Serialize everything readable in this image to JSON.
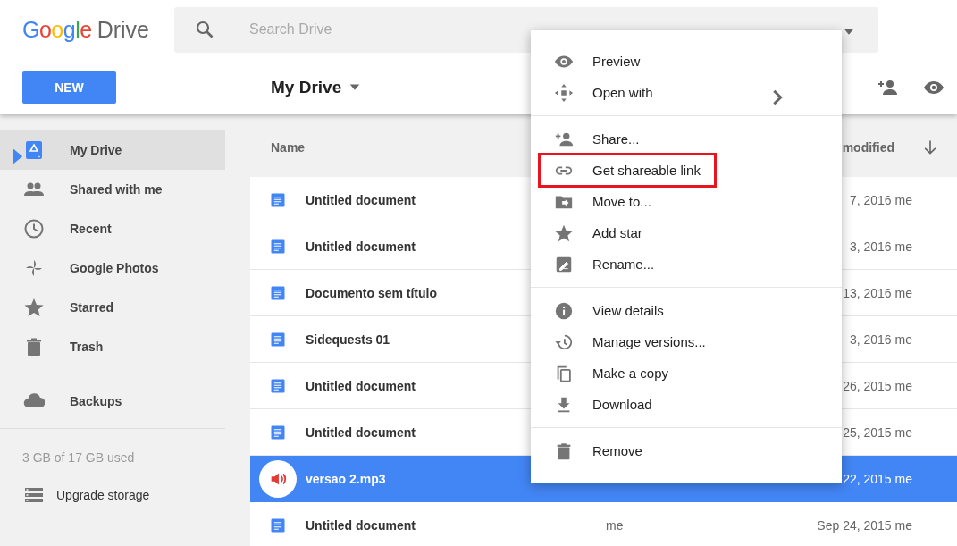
{
  "header": {
    "logo": "Google",
    "product": "Drive",
    "search": {
      "placeholder": "Search Drive"
    },
    "new_button": "NEW",
    "location": "My Drive"
  },
  "sidebar": {
    "items": [
      {
        "label": "My Drive",
        "selected": true,
        "expandable": true
      },
      {
        "label": "Shared with me",
        "selected": false,
        "expandable": false
      },
      {
        "label": "Recent",
        "selected": false,
        "expandable": false
      },
      {
        "label": "Google Photos",
        "selected": false,
        "expandable": false
      },
      {
        "label": "Starred",
        "selected": false,
        "expandable": false
      },
      {
        "label": "Trash",
        "selected": false,
        "expandable": false
      }
    ],
    "backups": "Backups",
    "storage": "3 GB of 17 GB used",
    "upgrade": "Upgrade storage"
  },
  "file_list": {
    "columns": [
      "Name",
      "modified"
    ],
    "rows": [
      {
        "kind": "doc",
        "name": "Untitled document",
        "date": "7, 2016 me",
        "selected": false
      },
      {
        "kind": "doc",
        "name": "Untitled document",
        "date": "3, 2016 me",
        "selected": false
      },
      {
        "kind": "doc",
        "name": "Documento sem título",
        "date": "13, 2016 me",
        "selected": false
      },
      {
        "kind": "doc",
        "name": "Sidequests 01",
        "date": "3, 2016 me",
        "selected": false
      },
      {
        "kind": "doc",
        "name": "Untitled document",
        "date": "26, 2015 me",
        "selected": false
      },
      {
        "kind": "doc",
        "name": "Untitled document",
        "date": "25, 2015 me",
        "selected": false
      },
      {
        "kind": "audio",
        "name": "versao 2.mp3",
        "date": "22, 2015 me",
        "selected": true
      },
      {
        "kind": "doc",
        "name": "Untitled document",
        "owner": "me",
        "date": "Sep 24, 2015 me",
        "selected": false
      }
    ]
  },
  "context_menu": {
    "groups": [
      [
        {
          "label": "Preview",
          "submenu": false,
          "highlighted": false
        },
        {
          "label": "Open with",
          "submenu": true,
          "highlighted": false
        }
      ],
      [
        {
          "label": "Share...",
          "submenu": false,
          "highlighted": false
        },
        {
          "label": "Get shareable link",
          "submenu": false,
          "highlighted": true
        },
        {
          "label": "Move to...",
          "submenu": false,
          "highlighted": false
        },
        {
          "label": "Add star",
          "submenu": false,
          "highlighted": false
        },
        {
          "label": "Rename...",
          "submenu": false,
          "highlighted": false
        }
      ],
      [
        {
          "label": "View details",
          "submenu": false,
          "highlighted": false
        },
        {
          "label": "Manage versions...",
          "submenu": false,
          "highlighted": false
        },
        {
          "label": "Make a copy",
          "submenu": false,
          "highlighted": false
        },
        {
          "label": "Download",
          "submenu": false,
          "highlighted": false
        }
      ],
      [
        {
          "label": "Remove",
          "submenu": false,
          "highlighted": false
        }
      ]
    ]
  }
}
